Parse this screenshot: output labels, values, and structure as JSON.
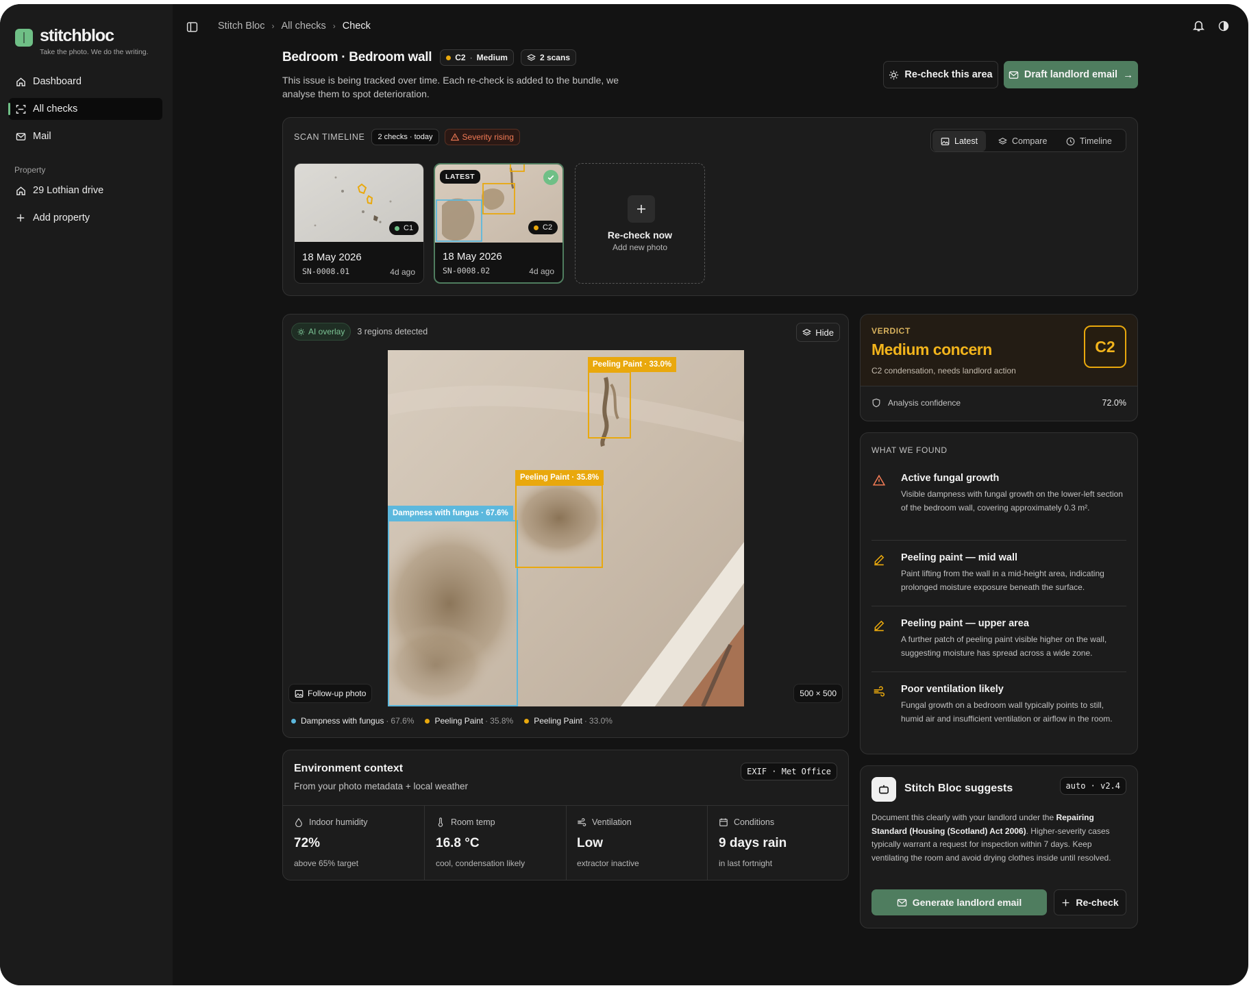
{
  "sidebar": {
    "brand": "stitchbloc",
    "tagline": "Take the photo. We do the writing.",
    "nav": [
      {
        "label": "Dashboard",
        "icon": "home-icon"
      },
      {
        "label": "All checks",
        "icon": "scan-icon"
      },
      {
        "label": "Mail",
        "icon": "mail-icon"
      }
    ],
    "section_label": "Property",
    "property": "29 Lothian drive",
    "add_property": "Add property"
  },
  "breadcrumb": [
    "Stitch Bloc",
    "All checks",
    "Check"
  ],
  "header": {
    "title": "Bedroom · Bedroom wall",
    "severity_badge": "C2",
    "severity_text": "Medium",
    "scans_badge": "2 scans",
    "description": "This issue is being tracked over time. Each re-check is added to the bundle, we analyse them to spot deterioration.",
    "recheck_button": "Re-check this area",
    "draft_button": "Draft landlord email"
  },
  "timeline": {
    "label": "SCAN TIMELINE",
    "count_badge": "2 checks · today",
    "trend_badge": "Severity rising",
    "views": [
      "Latest",
      "Compare",
      "Timeline"
    ],
    "scans": [
      {
        "date": "18 May 2026",
        "sn": "SN-0008.01",
        "ago": "4d ago",
        "grade": "C1"
      },
      {
        "date": "18 May 2026",
        "sn": "SN-0008.02",
        "ago": "4d ago",
        "grade": "C2",
        "latest": "LATEST"
      }
    ],
    "recheck_title": "Re-check now",
    "recheck_sub": "Add new photo"
  },
  "viewer": {
    "overlay_badge": "AI overlay",
    "regions_text": "3 regions detected",
    "hide_button": "Hide",
    "photo_label": "Follow-up photo",
    "dimensions": "500 × 500",
    "detections": [
      {
        "label": "Dampness with fungus",
        "score": "67.6%",
        "color": "#5cb8dd"
      },
      {
        "label": "Peeling Paint",
        "score": "35.8%",
        "color": "#e9a80d"
      },
      {
        "label": "Peeling Paint",
        "score": "33.0%",
        "color": "#e9a80d"
      }
    ]
  },
  "verdict": {
    "label": "VERDICT",
    "title": "Medium concern",
    "grade": "C2",
    "subtitle": "C2 condensation, needs landlord action",
    "confidence_label": "Analysis confidence",
    "confidence_value": "72.0%"
  },
  "findings": {
    "label": "WHAT WE FOUND",
    "items": [
      {
        "title": "Active fungal growth",
        "desc": "Visible dampness with fungal growth on the lower-left section of the bedroom wall, covering approximately 0.3 m².",
        "icon": "warning-icon"
      },
      {
        "title": "Peeling paint — mid wall",
        "desc": "Paint lifting from the wall in a mid-height area, indicating prolonged moisture exposure beneath the surface.",
        "icon": "pencil-icon"
      },
      {
        "title": "Peeling paint — upper area",
        "desc": "A further patch of peeling paint visible higher on the wall, suggesting moisture has spread across a wide zone.",
        "icon": "pencil-icon"
      },
      {
        "title": "Poor ventilation likely",
        "desc": "Fungal growth on a bedroom wall typically points to still, humid air and insufficient ventilation or airflow in the room.",
        "icon": "wind-icon"
      }
    ]
  },
  "environment": {
    "title": "Environment context",
    "subtitle": "From your photo metadata + local weather",
    "source_badge": "EXIF · Met Office",
    "metrics": [
      {
        "label": "Indoor humidity",
        "value": "72%",
        "sub": "above 65% target"
      },
      {
        "label": "Room temp",
        "value": "16.8 °C",
        "sub": "cool, condensation likely"
      },
      {
        "label": "Ventilation",
        "value": "Low",
        "sub": "extractor inactive"
      },
      {
        "label": "Conditions",
        "value": "9 days rain",
        "sub": "in last fortnight"
      }
    ]
  },
  "suggest": {
    "title": "Stitch Bloc suggests",
    "version": "auto · v2.4",
    "body_pre": "Document this clearly with your landlord under the ",
    "body_bold": "Repairing Standard (Housing (Scotland) Act 2006)",
    "body_post": ". Higher-severity cases typically warrant a request for inspection within 7 days. Keep ventilating the room and avoid drying clothes inside until resolved.",
    "generate_button": "Generate landlord email",
    "recheck_button": "Re-check"
  },
  "colors": {
    "accent": "#4f7d5f",
    "accent_light": "#6fbf86",
    "warning": "#e9a80d",
    "info": "#5cb8dd",
    "verdict_bg": "#231c14",
    "verdict_text": "#f2b41c"
  }
}
